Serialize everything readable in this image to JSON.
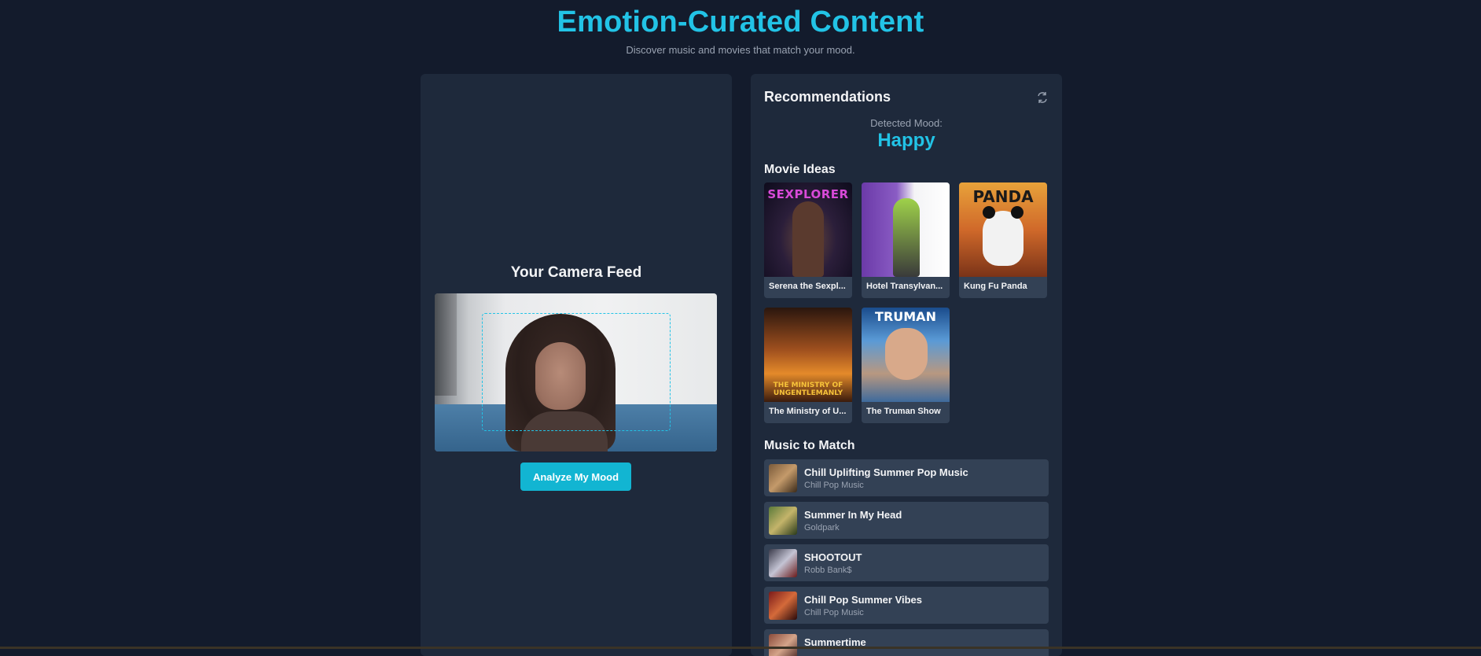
{
  "header": {
    "title": "Emotion-Curated Content",
    "subtitle": "Discover music and movies that match your mood."
  },
  "camera": {
    "title": "Your Camera Feed",
    "analyze_label": "Analyze My Mood"
  },
  "recommendations": {
    "title": "Recommendations",
    "refresh_icon": "refresh-icon",
    "mood_label": "Detected Mood:",
    "mood_value": "Happy",
    "movies_title": "Movie Ideas",
    "movies": [
      {
        "title": "Serena the Sexpl...",
        "poster_text": "SEXPLORER"
      },
      {
        "title": "Hotel Transylvan..."
      },
      {
        "title": "Kung Fu Panda",
        "poster_text": "PANDA"
      },
      {
        "title": "The Ministry of U...",
        "poster_text": "THE MINISTRY OF UNGENTLEMANLY"
      },
      {
        "title": "The Truman Show",
        "poster_text": "TRUMAN"
      }
    ],
    "music_title": "Music to Match",
    "music": [
      {
        "title": "Chill Uplifting Summer Pop Music",
        "artist": "Chill Pop Music"
      },
      {
        "title": "Summer In My Head",
        "artist": "Goldpark"
      },
      {
        "title": "SHOOTOUT",
        "artist": "Robb Bank$"
      },
      {
        "title": "Chill Pop Summer Vibes",
        "artist": "Chill Pop Music"
      },
      {
        "title": "Summertime",
        "artist": ""
      }
    ]
  },
  "colors": {
    "background": "#131b2c",
    "panel": "#1e293b",
    "card": "#334155",
    "accent": "#22c3e6",
    "button": "#12b5d2"
  }
}
